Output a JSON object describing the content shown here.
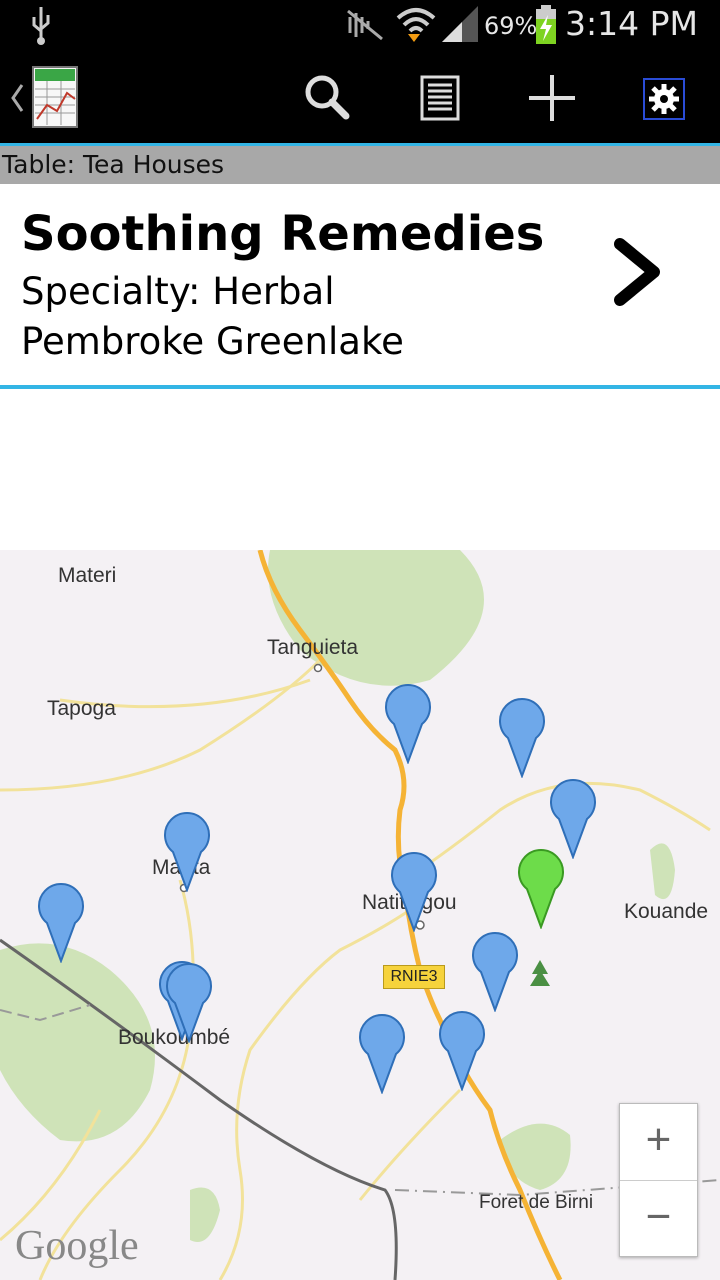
{
  "status_bar": {
    "battery_percent": "69%",
    "time": "3:14 PM",
    "icons": [
      "usb-icon",
      "mute-icon",
      "wifi-icon",
      "signal-icon",
      "battery-icon"
    ]
  },
  "action_bar": {
    "icons": [
      "back-caret-icon",
      "app-spreadsheet-icon",
      "search-icon",
      "list-icon",
      "add-icon",
      "settings-icon"
    ]
  },
  "table_header": "Table: Tea Houses",
  "detail": {
    "title": "Soothing Remedies",
    "specialty": "Specialty: Herbal",
    "location": "Pembroke Greenlake"
  },
  "map": {
    "labels": {
      "materi": "Materi",
      "tanguieta": "Tanguieta",
      "tapoga": "Tapoga",
      "manta": "Manta",
      "natitingou": "Natitingou",
      "kouande": "Kouande",
      "boukoumbe": "Boukoumbé",
      "foret": "Foret de Birni"
    },
    "road_shield": "RNIE3",
    "zoom_in": "+",
    "zoom_out": "−",
    "attribution": "Google",
    "colors": {
      "pin_blue": "#6ea8ea",
      "pin_green": "#6ddc4a",
      "road": "#f5b335"
    }
  }
}
